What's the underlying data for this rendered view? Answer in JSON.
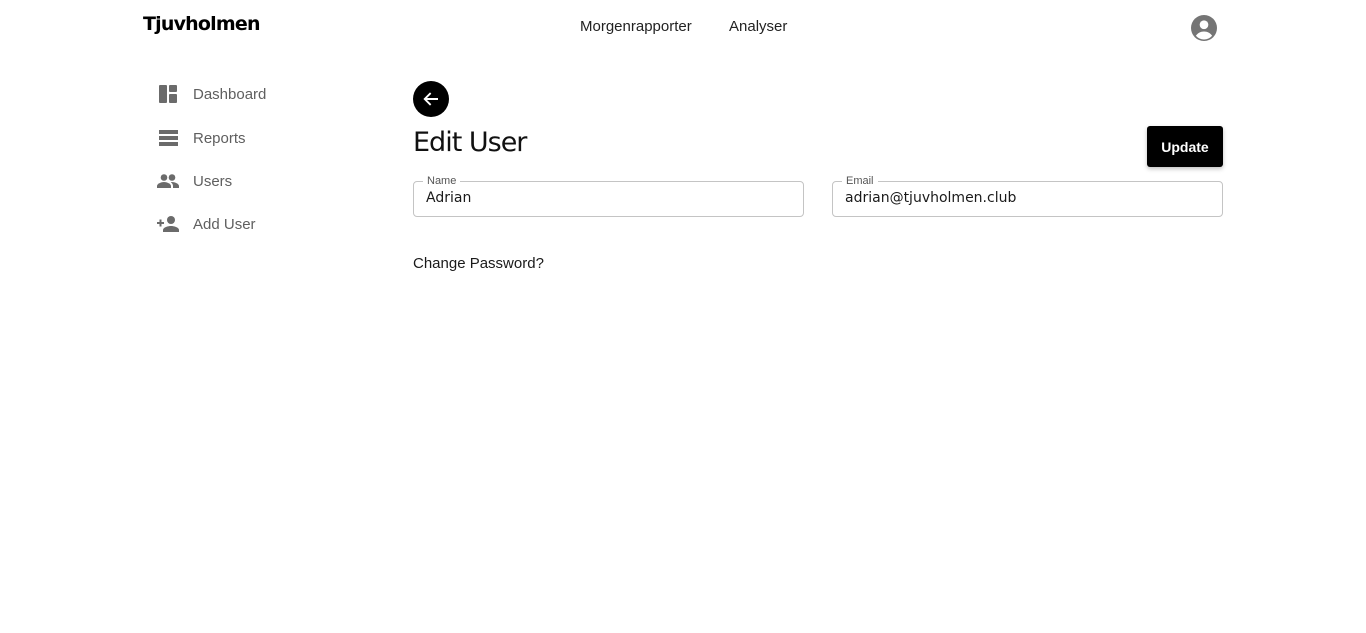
{
  "header": {
    "brand": "Tjuvholmen",
    "nav": [
      {
        "label": "Morgenrapporter"
      },
      {
        "label": "Analyser"
      }
    ],
    "account_icon": "account-circle-icon"
  },
  "sidebar": {
    "items": [
      {
        "label": "Dashboard",
        "icon": "dashboard-icon"
      },
      {
        "label": "Reports",
        "icon": "list-icon"
      },
      {
        "label": "Users",
        "icon": "people-icon"
      },
      {
        "label": "Add User",
        "icon": "person-add-icon"
      }
    ]
  },
  "main": {
    "back_icon": "arrow-back-icon",
    "title": "Edit User",
    "update_label": "Update",
    "fields": {
      "name": {
        "label": "Name",
        "value": "Adrian"
      },
      "email": {
        "label": "Email",
        "value": "adrian@tjuvholmen.club"
      }
    },
    "change_password": "Change Password?"
  },
  "colors": {
    "accent": "#000000",
    "sidebar_icon": "#6b6b6b",
    "account_icon": "#757575",
    "field_border": "#c4c4c4"
  }
}
